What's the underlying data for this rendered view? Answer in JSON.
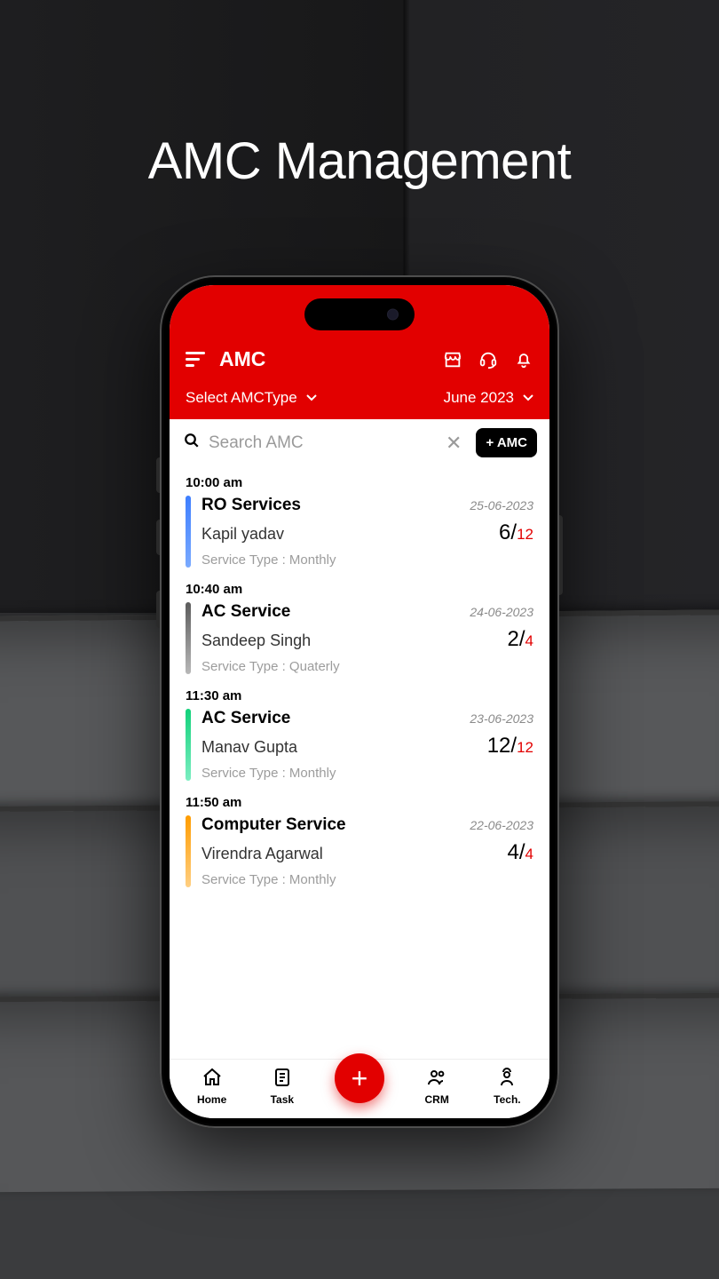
{
  "promo_title": "AMC Management",
  "header": {
    "title": "AMC",
    "amc_type_label": "Select AMCType",
    "month_label": "June 2023"
  },
  "search": {
    "placeholder": "Search AMC"
  },
  "add_button_label": "+ AMC",
  "items": [
    {
      "time": "10:00 am",
      "color": "linear-gradient(#3d7eff,#7aaaff)",
      "service_name": "RO Services",
      "date": "25-06-2023",
      "customer": "Kapil yadav",
      "done": "6",
      "total": "12",
      "service_type_label": "Service Type : Monthly"
    },
    {
      "time": "10:40 am",
      "color": "linear-gradient(#5c5c5c,#b8b8b8)",
      "service_name": "AC Service",
      "date": "24-06-2023",
      "customer": "Sandeep Singh",
      "done": "2",
      "total": "4",
      "service_type_label": "Service Type : Quaterly"
    },
    {
      "time": "11:30 am",
      "color": "linear-gradient(#11d17a,#7beec1)",
      "service_name": "AC Service",
      "date": "23-06-2023",
      "customer": "Manav Gupta",
      "done": "12",
      "total": "12",
      "service_type_label": "Service Type : Monthly"
    },
    {
      "time": "11:50 am",
      "color": "linear-gradient(#ff9c00,#ffcf82)",
      "service_name": "Computer Service",
      "date": "22-06-2023",
      "customer": "Virendra Agarwal",
      "done": "4",
      "total": "4",
      "service_type_label": "Service Type : Monthly"
    }
  ],
  "nav": {
    "home": "Home",
    "task": "Task",
    "crm": "CRM",
    "tech": "Tech."
  }
}
